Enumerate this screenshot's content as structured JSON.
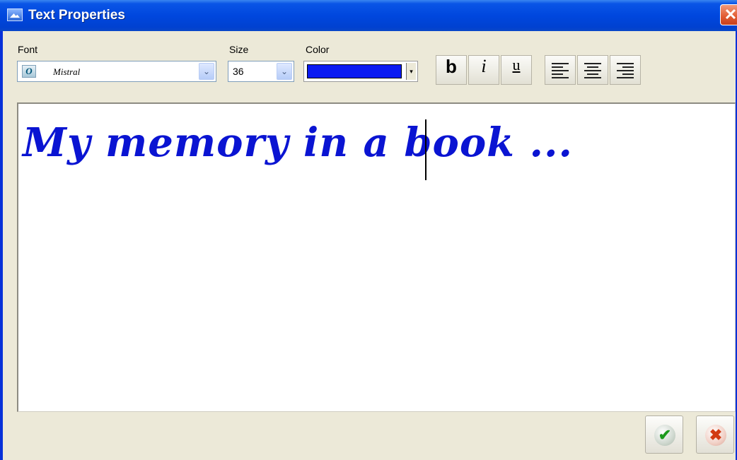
{
  "window": {
    "title": "Text Properties",
    "close_glyph": "✕"
  },
  "toolbar": {
    "font_label": "Font",
    "font_value": "Mistral",
    "font_icon_glyph": "O",
    "size_label": "Size",
    "size_value": "36",
    "color_label": "Color",
    "color_value": "#0a1af2",
    "bold_label": "b",
    "italic_label": "i",
    "underline_label": "u",
    "dropdown_glyph": "⌄"
  },
  "editor": {
    "text": "My memory in a book ...",
    "text_color": "#0a14d2"
  },
  "footer": {
    "ok_glyph": "✔",
    "cancel_glyph": "✖"
  },
  "icons": [
    "app-icon",
    "close-icon",
    "font-type-icon",
    "chevron-down-icon",
    "bold-icon",
    "italic-icon",
    "underline-icon",
    "align-left-icon",
    "align-center-icon",
    "align-right-icon",
    "checkmark-icon",
    "cross-icon"
  ]
}
